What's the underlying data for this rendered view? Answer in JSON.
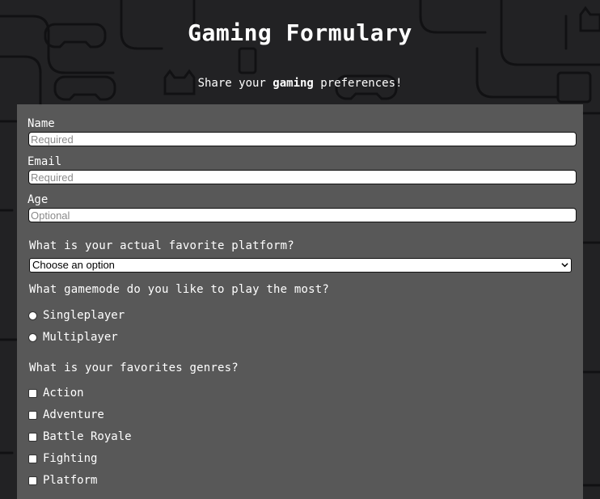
{
  "header": {
    "title": "Gaming Formulary",
    "subtitle_pre": "Share your ",
    "subtitle_bold": "gaming",
    "subtitle_post": " preferences!"
  },
  "form": {
    "name": {
      "label": "Name",
      "placeholder": "Required",
      "value": ""
    },
    "email": {
      "label": "Email",
      "placeholder": "Required",
      "value": ""
    },
    "age": {
      "label": "Age",
      "placeholder": "Optional",
      "value": ""
    },
    "platform": {
      "question": "What is your actual favorite platform?",
      "selected": "Choose an option"
    },
    "gamemode": {
      "question": "What gamemode do you like to play the most?",
      "options": [
        "Singleplayer",
        "Multiplayer"
      ]
    },
    "genres": {
      "question": "What is your favorites genres?",
      "options": [
        "Action",
        "Adventure",
        "Battle Royale",
        "Fighting",
        "Platform"
      ]
    }
  },
  "colors": {
    "background": "#222224",
    "panel": "#646464",
    "text": "#ffffff"
  }
}
